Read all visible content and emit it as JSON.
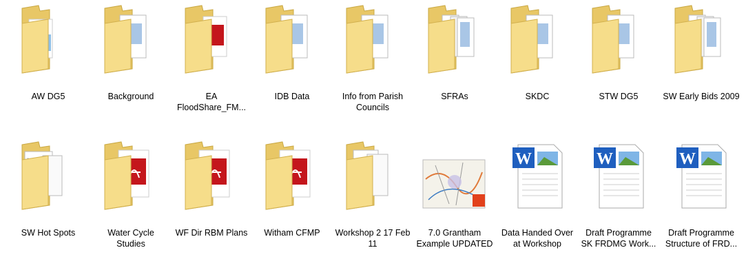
{
  "window": {
    "title": ""
  },
  "items": [
    {
      "label": "AW DG5",
      "type": "folder",
      "preview": "chart-doc",
      "icon": "folder-icon"
    },
    {
      "label": "Background",
      "type": "folder",
      "preview": "blue-doc",
      "icon": "folder-icon"
    },
    {
      "label": "EA FloodShare_FM...",
      "type": "folder",
      "preview": "red-doc",
      "icon": "folder-icon"
    },
    {
      "label": "IDB Data",
      "type": "folder",
      "preview": "blue-doc",
      "icon": "folder-icon"
    },
    {
      "label": "Info from Parish Councils",
      "type": "folder",
      "preview": "blue-doc",
      "icon": "folder-icon"
    },
    {
      "label": "SFRAs",
      "type": "folder",
      "preview": "multi-doc",
      "icon": "folder-icon"
    },
    {
      "label": "SKDC",
      "type": "folder",
      "preview": "blue-doc",
      "icon": "folder-icon"
    },
    {
      "label": "STW DG5",
      "type": "folder",
      "preview": "blue-doc",
      "icon": "folder-icon"
    },
    {
      "label": "SW Early Bids 2009",
      "type": "folder",
      "preview": "multi-doc",
      "icon": "folder-icon"
    },
    {
      "label": "SW Hot Spots",
      "type": "folder",
      "preview": "map-doc",
      "icon": "folder-icon"
    },
    {
      "label": "Water Cycle Studies",
      "type": "folder",
      "preview": "pdf-doc",
      "icon": "folder-icon"
    },
    {
      "label": "WF Dir RBM Plans",
      "type": "folder",
      "preview": "pdf-doc",
      "icon": "folder-icon"
    },
    {
      "label": "Witham CFMP",
      "type": "folder",
      "preview": "pdf-doc",
      "icon": "folder-icon"
    },
    {
      "label": "Workshop 2 17 Feb 11",
      "type": "folder",
      "preview": "green-doc",
      "icon": "folder-icon"
    },
    {
      "label": "7.0 Grantham Example UPDATED",
      "type": "map-file",
      "preview": "map",
      "icon": "map-file-icon"
    },
    {
      "label": "Data Handed Over at Workshop",
      "type": "word-file",
      "preview": "word",
      "icon": "word-document-icon"
    },
    {
      "label": "Draft Programme SK FRDMG Work...",
      "type": "word-file",
      "preview": "word",
      "icon": "word-document-icon"
    },
    {
      "label": "Draft Programme Structure of FRD...",
      "type": "word-file",
      "preview": "word",
      "icon": "word-document-icon"
    }
  ],
  "colors": {
    "folder_back": "#e8c766",
    "folder_front": "#f6dd8a",
    "pdf_red": "#c4161c",
    "word_blue": "#1f5fbf",
    "map_badge": "#e2411c"
  }
}
